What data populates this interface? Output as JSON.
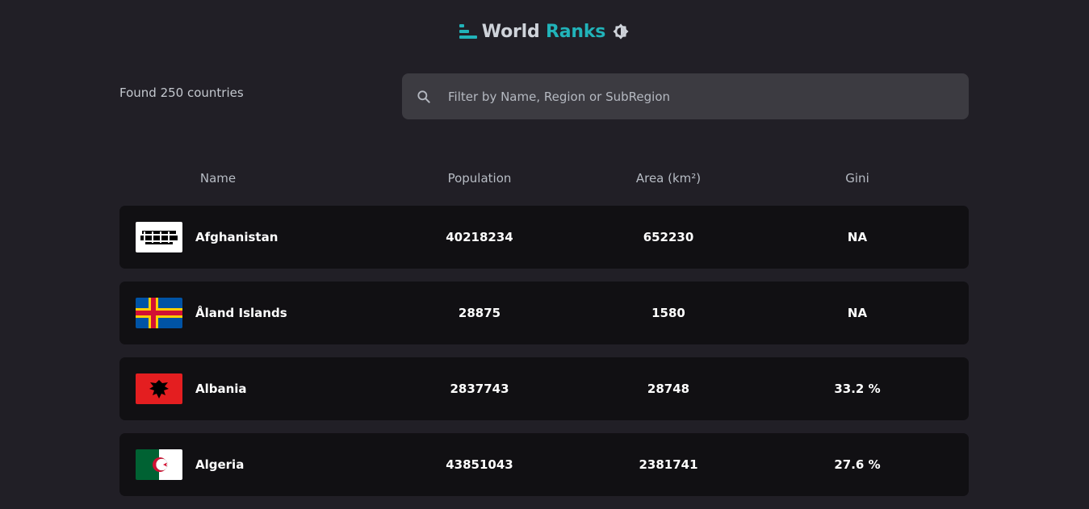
{
  "header": {
    "title_part1": "World",
    "title_part2": "Ranks",
    "logo_icon": "bars-logo-icon",
    "theme_icon": "brightness-icon",
    "accent_color": "#21b3b9"
  },
  "summary": {
    "found_text": "Found 250 countries"
  },
  "search": {
    "placeholder": "Filter by Name, Region or SubRegion",
    "value": ""
  },
  "table": {
    "columns": [
      "Name",
      "Population",
      "Area (km²)",
      "Gini"
    ],
    "rows": [
      {
        "flag": "flag-afghanistan",
        "name": "Afghanistan",
        "population": "40218234",
        "area": "652230",
        "gini": "NA"
      },
      {
        "flag": "flag-aland-islands",
        "name": "Åland Islands",
        "population": "28875",
        "area": "1580",
        "gini": "NA"
      },
      {
        "flag": "flag-albania",
        "name": "Albania",
        "population": "2837743",
        "area": "28748",
        "gini": "33.2 %"
      },
      {
        "flag": "flag-algeria",
        "name": "Algeria",
        "population": "43851043",
        "area": "2381741",
        "gini": "27.6 %"
      }
    ]
  }
}
